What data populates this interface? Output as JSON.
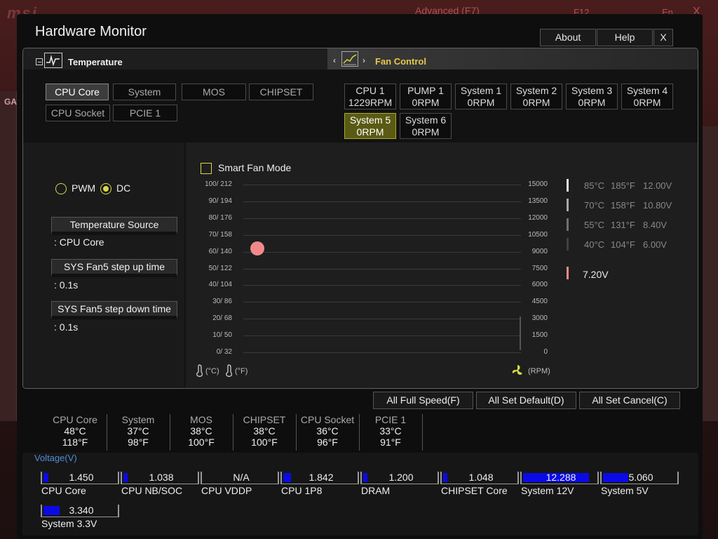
{
  "background": {
    "advanced": "Advanced (F7)",
    "f12": "F12",
    "lang": "En",
    "close": "X",
    "side_tab": "GA"
  },
  "window": {
    "title": "Hardware Monitor",
    "buttons": {
      "about": "About",
      "help": "Help",
      "close": "X"
    }
  },
  "tabs": {
    "temperature": "Temperature",
    "fan_control": "Fan Control"
  },
  "sources": {
    "row1": [
      "CPU Core",
      "System",
      "MOS",
      "CHIPSET"
    ],
    "row2": [
      "CPU Socket",
      "PCIE 1"
    ],
    "active": "CPU Core"
  },
  "fans": [
    {
      "name": "CPU 1",
      "rpm": "1229RPM"
    },
    {
      "name": "PUMP 1",
      "rpm": "0RPM"
    },
    {
      "name": "System 1",
      "rpm": "0RPM"
    },
    {
      "name": "System 2",
      "rpm": "0RPM"
    },
    {
      "name": "System 3",
      "rpm": "0RPM"
    },
    {
      "name": "System 4",
      "rpm": "0RPM"
    },
    {
      "name": "System 5",
      "rpm": "0RPM"
    },
    {
      "name": "System 6",
      "rpm": "0RPM"
    }
  ],
  "active_fan": "System 5",
  "mode": {
    "pwm": "PWM",
    "dc": "DC",
    "selected": "DC"
  },
  "settings": {
    "temp_source_btn": "Temperature Source",
    "temp_source_val": ": CPU Core",
    "step_up_btn": "SYS Fan5 step up time",
    "step_up_val": ": 0.1s",
    "step_down_btn": "SYS Fan5 step down time",
    "step_down_val": ": 0.1s"
  },
  "smart_fan_label": "Smart Fan Mode",
  "chart": {
    "left_ticks": [
      "100/ 212",
      "90/ 194",
      "80/ 176",
      "70/ 158",
      "60/ 140",
      "50/ 122",
      "40/ 104",
      "30/  86",
      "20/  68",
      "10/  50",
      "0/  32"
    ],
    "right_ticks": [
      "15000",
      "13500",
      "12000",
      "10500",
      "9000",
      "7500",
      "6000",
      "4500",
      "3000",
      "1500",
      "0"
    ],
    "unit_c": "(°C)",
    "unit_f": "(°F)",
    "unit_rpm": "(RPM)",
    "point_color": "#f08a8a"
  },
  "legend": [
    {
      "c": "85°C",
      "f": "185°F",
      "v": "12.00V",
      "color": "#e6e6e6"
    },
    {
      "c": "70°C",
      "f": "158°F",
      "v": "10.80V",
      "color": "#a8a8a8"
    },
    {
      "c": "55°C",
      "f": "131°F",
      "v": "8.40V",
      "color": "#707070"
    },
    {
      "c": "40°C",
      "f": "104°F",
      "v": "6.00V",
      "color": "#404040"
    }
  ],
  "current_voltage": {
    "value": "7.20V",
    "color": "#f08a8a"
  },
  "actions": {
    "full_speed": "All Full Speed(F)",
    "set_default": "All Set Default(D)",
    "set_cancel": "All Set Cancel(C)"
  },
  "temps": [
    {
      "name": "CPU Core",
      "c": "48°C",
      "f": "118°F"
    },
    {
      "name": "System",
      "c": "37°C",
      "f": "98°F"
    },
    {
      "name": "MOS",
      "c": "38°C",
      "f": "100°F"
    },
    {
      "name": "CHIPSET",
      "c": "38°C",
      "f": "100°F"
    },
    {
      "name": "CPU Socket",
      "c": "36°C",
      "f": "96°F"
    },
    {
      "name": "PCIE 1",
      "c": "33°C",
      "f": "91°F"
    }
  ],
  "voltage_title": "Voltage(V)",
  "voltages": [
    {
      "name": "CPU Core",
      "value": "1.450",
      "fill": 0.07
    },
    {
      "name": "CPU NB/SOC",
      "value": "1.038",
      "fill": 0.06
    },
    {
      "name": "CPU VDDP",
      "value": "N/A",
      "fill": 0
    },
    {
      "name": "CPU 1P8",
      "value": "1.842",
      "fill": 0.11
    },
    {
      "name": "DRAM",
      "value": "1.200",
      "fill": 0.06
    },
    {
      "name": "CHIPSET Core",
      "value": "1.048",
      "fill": 0.06
    },
    {
      "name": "System 12V",
      "value": "12.288",
      "fill": 0.9
    },
    {
      "name": "System 5V",
      "value": "5.060",
      "fill": 0.35
    },
    {
      "name": "System 3.3V",
      "value": "3.340",
      "fill": 0.22
    }
  ]
}
